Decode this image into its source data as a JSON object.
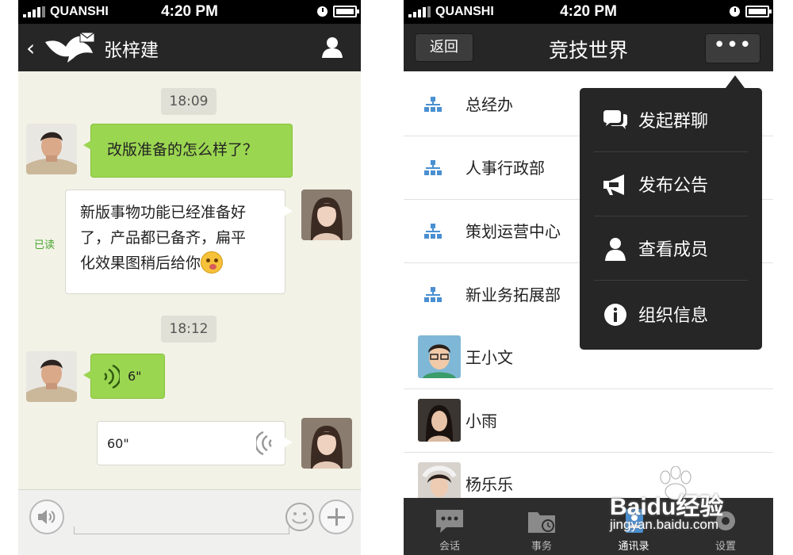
{
  "status": {
    "carrier": "QUANSHI",
    "time": "4:20 PM"
  },
  "chat": {
    "title": "张梓建",
    "time1": "18:09",
    "msg1": "改版准备的怎么样了？",
    "msg2_lines": [
      "新版事物功能已经准备好",
      "了，产品都已备齐，扁平",
      "化效果图稍后给你"
    ],
    "read_status": "已读",
    "time2": "18:12",
    "voice1_duration": "6\"",
    "voice2_duration": "60\""
  },
  "contacts": {
    "back_label": "返回",
    "title": "竞技世界",
    "more_label": "•••",
    "departments": [
      "总经办",
      "人事行政部",
      "策划运营中心",
      "新业务拓展部"
    ],
    "people": [
      "王小文",
      "小雨",
      "杨乐乐"
    ]
  },
  "menu": {
    "items": [
      {
        "label": "发起群聊",
        "icon": "group-chat-icon"
      },
      {
        "label": "发布公告",
        "icon": "announcement-icon"
      },
      {
        "label": "查看成员",
        "icon": "member-icon"
      },
      {
        "label": "组织信息",
        "icon": "info-icon"
      }
    ]
  },
  "tabs": [
    {
      "label": "会话",
      "icon": "chat-icon"
    },
    {
      "label": "事务",
      "icon": "task-icon"
    },
    {
      "label": "通讯录",
      "icon": "contacts-icon"
    },
    {
      "label": "设置",
      "icon": "settings-icon"
    }
  ],
  "watermark": {
    "brand": "Baidu经验",
    "url": "jingyan.baidu.com"
  },
  "colors": {
    "bubble_green": "#9bd651",
    "navbar": "#262626",
    "chat_bg": "#f2f2e6"
  }
}
